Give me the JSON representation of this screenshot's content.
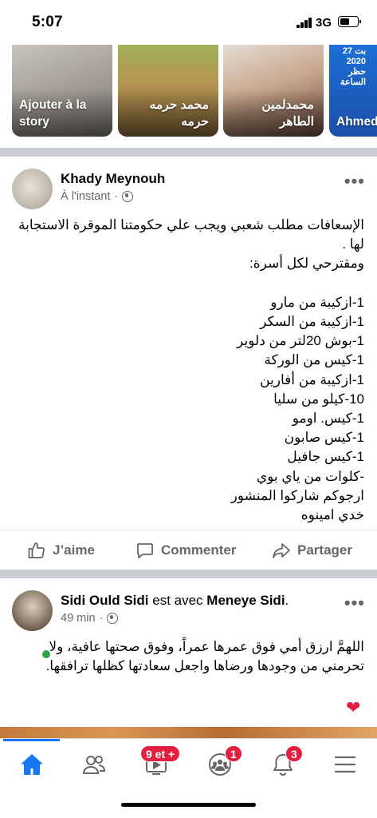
{
  "status_bar": {
    "time": "5:07",
    "network": "3G"
  },
  "stories": [
    {
      "label": "Ajouter à la story"
    },
    {
      "label": "محمد حرمه حرمه"
    },
    {
      "label": "محمدلمين الطاهر"
    },
    {
      "label": "Ahmed Moham",
      "overlay": "بت 27\n2020\nحظر\nالساعة"
    }
  ],
  "post1": {
    "author": "Khady Meynouh",
    "time": "À l'instant",
    "text": "الإسعافات مطلب شعبي ويجب علي حكومتنا الموقرة الاستجابة لها .\nومقترحي لكل أسرة:\n\n1-ازكيبة من مارو\n1-ازكيبة من السكر\n1-بوش 20لتر من دلوير\n1-كيس من الوركة\n1-ازكيبة من  أفارين\n10-كيلو من سليا\n1-كيس. اومو\n1-كيس صابون\n1-كيس جافيل\n-كلوات من ياي بوي\nارجوكم  شاركوا المنشور\nخدي امينوه",
    "actions": {
      "like": "J’aime",
      "comment": "Commenter",
      "share": "Partager"
    }
  },
  "post2": {
    "author": "Sidi Ould Sidi",
    "with_text": "est avec",
    "tagged": "Meneye Sidi",
    "period": ".",
    "time": "49 min",
    "text": "اللهمَّ ارزق أمي فوق عمرها عمراً، وفوق صحتها عافية، ولا تحرمني من وجودها ورضاها واجعل سعادتها كظلها ترافقها."
  },
  "bottom_nav": {
    "video_badge": "9 et +",
    "groups_badge": "1",
    "notifications_badge": "3"
  },
  "colors": {
    "accent": "#1877f2",
    "badge": "#e41e3f",
    "muted": "#65676b"
  }
}
